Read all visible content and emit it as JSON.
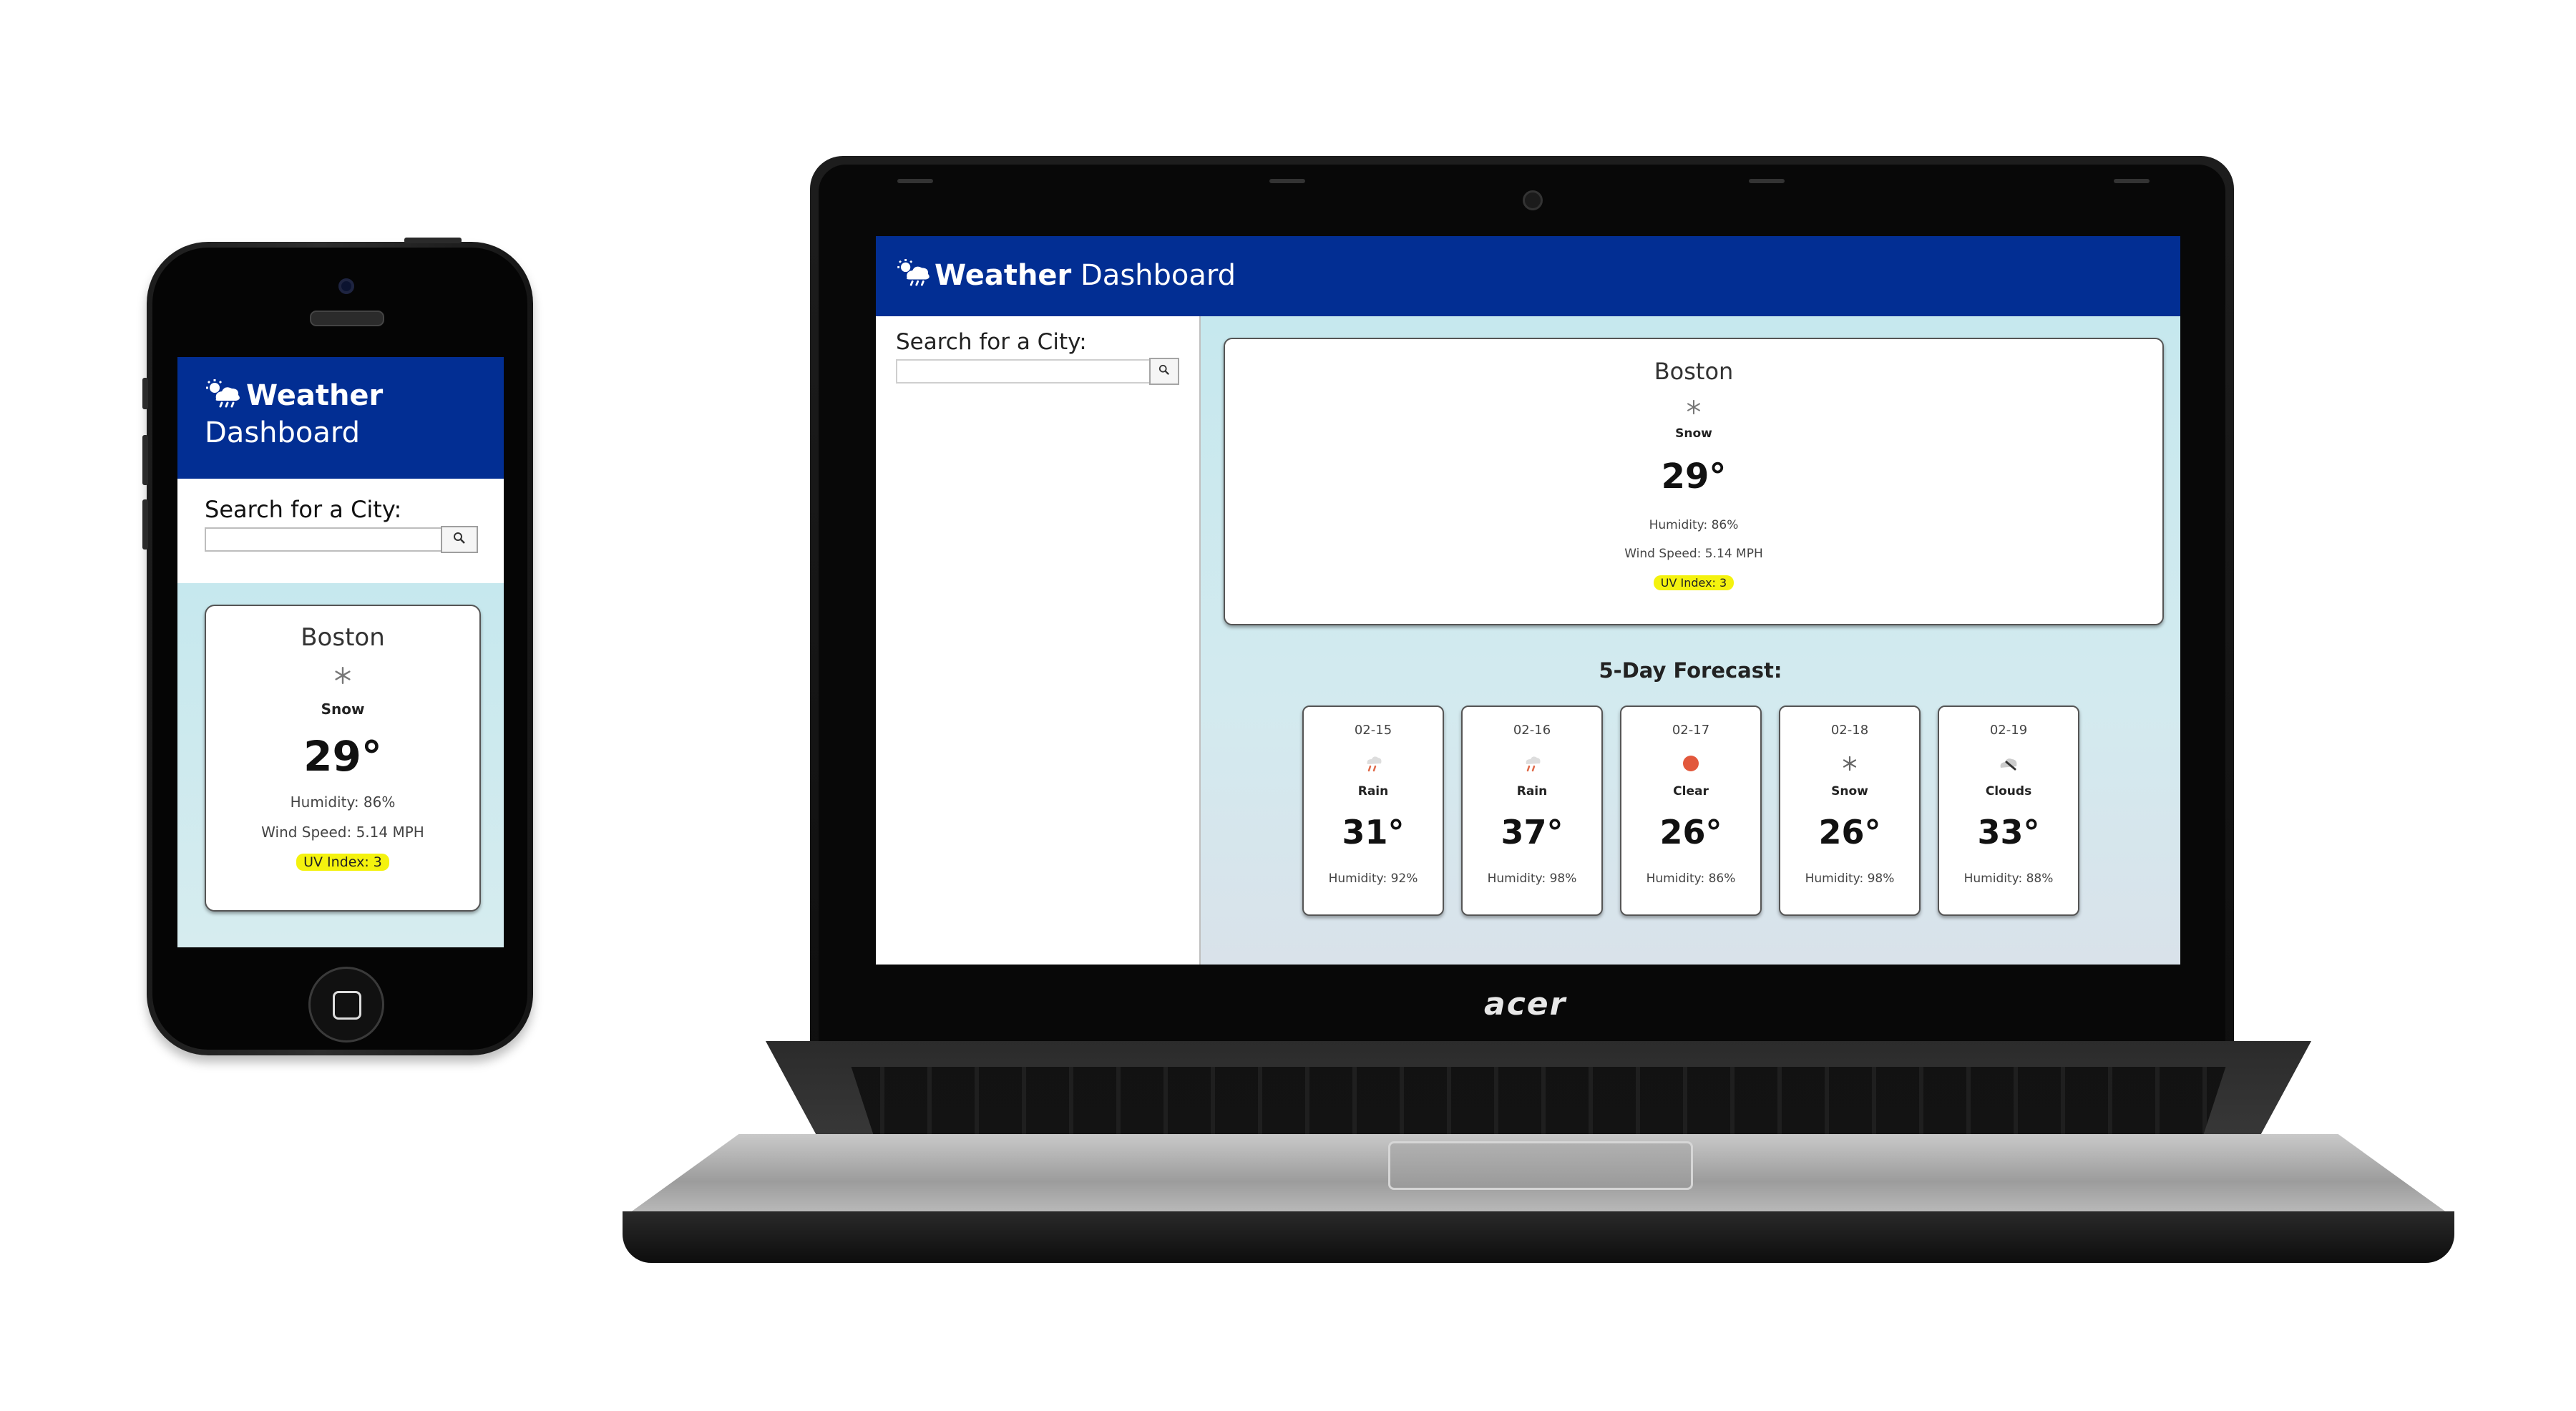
{
  "app": {
    "title_bold": "Weather",
    "title_rest": "Dashboard",
    "header_color": "#022e93",
    "header_icon": "cloud-sun-rain-icon"
  },
  "search": {
    "label": "Search for a City:",
    "value": "",
    "placeholder": "",
    "button_icon": "search-icon"
  },
  "current": {
    "city": "Boston",
    "condition_icon": "snowflake-icon",
    "condition": "Snow",
    "temperature": "29°",
    "humidity": "Humidity: 86%",
    "wind": "Wind Speed: 5.14 MPH",
    "uv": "UV Index: 3",
    "uv_color": "#f4f20e"
  },
  "forecast": {
    "title": "5-Day Forecast:",
    "days": [
      {
        "date": "02-15",
        "icon": "rain-icon",
        "condition": "Rain",
        "temp": "31°",
        "humidity": "Humidity: 92%"
      },
      {
        "date": "02-16",
        "icon": "rain-icon",
        "condition": "Rain",
        "temp": "37°",
        "humidity": "Humidity: 98%"
      },
      {
        "date": "02-17",
        "icon": "sun-icon",
        "condition": "Clear",
        "temp": "26°",
        "humidity": "Humidity: 86%"
      },
      {
        "date": "02-18",
        "icon": "snowflake-icon",
        "condition": "Snow",
        "temp": "26°",
        "humidity": "Humidity: 98%"
      },
      {
        "date": "02-19",
        "icon": "cloud-icon",
        "condition": "Clouds",
        "temp": "33°",
        "humidity": "Humidity: 88%"
      }
    ]
  },
  "device": {
    "laptop_logo": "acer"
  }
}
